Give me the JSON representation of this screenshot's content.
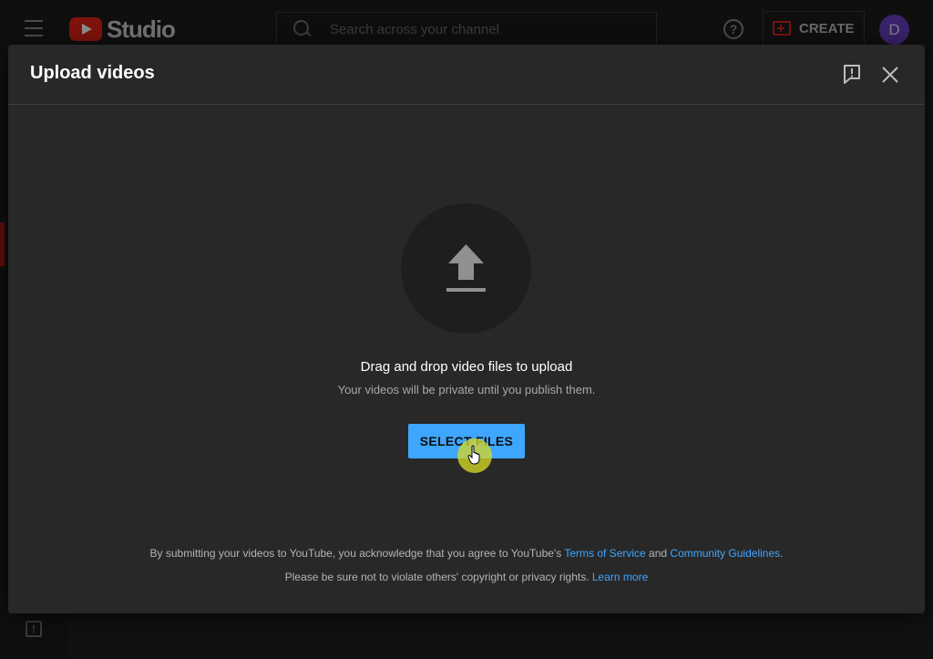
{
  "app": {
    "logo_text": "Studio",
    "search_placeholder": "Search across your channel",
    "help_glyph": "?",
    "create_label": "CREATE",
    "avatar_letter": "D",
    "feedback_glyph": "!"
  },
  "dialog": {
    "title": "Upload videos",
    "feedback_icon": "report-feedback-icon",
    "close_icon": "close-icon",
    "upload_icon": "upload-arrow-icon",
    "drop_title": "Drag and drop video files to upload",
    "drop_subtitle": "Your videos will be private until you publish them.",
    "select_button": "SELECT FILES",
    "legal_line1_prefix": "By submitting your videos to YouTube, you acknowledge that you agree to YouTube's ",
    "terms_link": "Terms of Service",
    "legal_and": " and ",
    "guidelines_link": "Community Guidelines",
    "legal_line1_suffix": ".",
    "legal_line2_prefix": "Please be sure not to violate others' copyright or privacy rights. ",
    "learn_more_link": "Learn more"
  },
  "colors": {
    "accent_blue": "#3ea6ff",
    "brand_red": "#e62117",
    "dialog_bg": "#282828",
    "cursor_highlight": "#d5d728"
  }
}
